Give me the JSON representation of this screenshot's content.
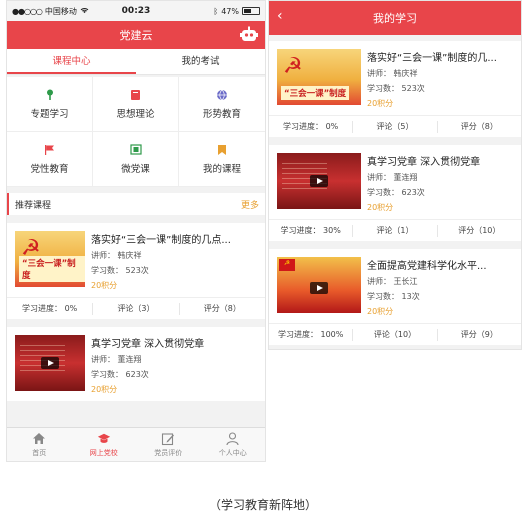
{
  "status_bar": {
    "carrier": "中国移动",
    "time": "00:23",
    "battery": "47%",
    "battery_level": 0.47
  },
  "left": {
    "app_title": "党建云",
    "tabs": [
      {
        "label": "课程中心",
        "active": true
      },
      {
        "label": "我的考试",
        "active": false
      }
    ],
    "grid": [
      {
        "label": "专题学习",
        "icon": "pin-icon",
        "color": "#2e9a4a"
      },
      {
        "label": "思想理论",
        "icon": "book-icon",
        "color": "#e8454a"
      },
      {
        "label": "形势教育",
        "icon": "globe-icon",
        "color": "#6a6ac8"
      },
      {
        "label": "党性教育",
        "icon": "flag-icon",
        "color": "#e8454a"
      },
      {
        "label": "微党课",
        "icon": "film-icon",
        "color": "#2e9a4a"
      },
      {
        "label": "我的课程",
        "icon": "bookmark-icon",
        "color": "#e8a030"
      }
    ],
    "section": {
      "title": "推荐课程",
      "more": "更多"
    },
    "courses": [
      {
        "title": "落实好“三会一课”制度的几点...",
        "teacher": "讲师： 韩庆祥",
        "count": "学习数： 523次",
        "points": "20积分",
        "thumb_text": "“三会一课”制度",
        "progress": "学习进度： 0%",
        "comments": "评论（3）",
        "rating": "评分（8）"
      },
      {
        "title": "真学习党章  深入贯彻党章",
        "teacher": "讲师： 董连翔",
        "count": "学习数： 623次",
        "points": "20积分"
      }
    ],
    "nav": [
      {
        "label": "首页",
        "icon": "home-icon",
        "active": false
      },
      {
        "label": "网上党校",
        "icon": "graduation-cap-icon",
        "active": true
      },
      {
        "label": "党员评价",
        "icon": "edit-icon",
        "active": false
      },
      {
        "label": "个人中心",
        "icon": "user-icon",
        "active": false
      }
    ]
  },
  "right": {
    "title": "我的学习",
    "back_glyph": "‹",
    "courses": [
      {
        "title": "落实好“三会一课”制度的几...",
        "teacher": "讲师： 韩庆祥",
        "count": "学习数： 523次",
        "points": "20积分",
        "thumb_text": "“三会一课”制度",
        "progress": "学习进度： 0%",
        "comments": "评论（5）",
        "rating": "评分（8）"
      },
      {
        "title": "真学习党章  深入贯彻党章",
        "teacher": "讲师： 董连翔",
        "count": "学习数： 623次",
        "points": "20积分",
        "progress": "学习进度： 30%",
        "comments": "评论（1）",
        "rating": "评分（10）"
      },
      {
        "title": "全面提高党建科学化水平...",
        "teacher": "讲师： 王长江",
        "count": "学习数： 13次",
        "points": "20积分",
        "progress": "学习进度： 100%",
        "comments": "评论（10）",
        "rating": "评分（9）"
      }
    ]
  },
  "caption": "（学习教育新阵地）",
  "colors": {
    "accent": "#e8454a",
    "points": "#e8a030"
  }
}
